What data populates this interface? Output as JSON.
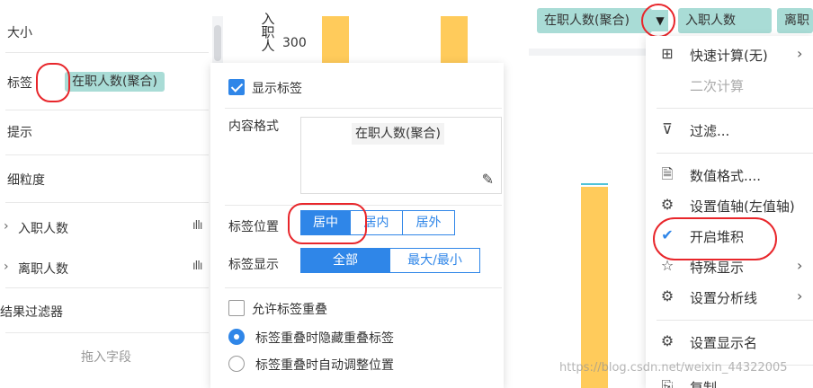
{
  "left_panel": {
    "rows": {
      "size": "大小",
      "label": "标签",
      "tooltip": "提示",
      "granularity": "细粒度",
      "field_hire": "入职人数",
      "field_leave": "离职人数",
      "result_filter": "结果过滤器"
    },
    "label_pill": "在职人数(聚合)",
    "bar_icon_1": "ıllı",
    "bar_icon_2": "ıllı",
    "tree_arrow_1": "›",
    "tree_arrow_2": "›",
    "drop_hint": "拖入字段"
  },
  "chart": {
    "y_axis_label": "入职人",
    "y_tick": "300",
    "bar_color": "#ffcb5b",
    "top_pills": {
      "employees": "在职人数(聚合)",
      "hires": "入职人数",
      "leaves": "离职"
    },
    "dropdown_arrow": "▼"
  },
  "label_popup": {
    "show_label": "显示标签",
    "content_format": "内容格式",
    "format_token": "在职人数(聚合)",
    "edit_icon": "✎",
    "label_position": "标签位置",
    "position_options": [
      "居中",
      "居内",
      "居外"
    ],
    "position_selected": "居中",
    "label_display": "标签显示",
    "display_options": [
      "全部",
      "最大/最小"
    ],
    "display_selected": "全部",
    "allow_overlap": "允许标签重叠",
    "overlap_hide": "标签重叠时隐藏重叠标签",
    "overlap_adjust": "标签重叠时自动调整位置",
    "accent": "#2f86e8"
  },
  "context_menu": {
    "quick_calc": "快速计算(无)",
    "secondary_calc": "二次计算",
    "filter": "过滤...",
    "number_format": "数值格式....",
    "set_axis": "设置值轴(左值轴)",
    "enable_stack": "开启堆积",
    "special_display": "特殊显示",
    "analysis_line": "设置分析线",
    "display_name": "设置显示名",
    "copy": "复制",
    "icons": {
      "quick_calc": "⊞",
      "filter": "⊽",
      "number_format": "🗎",
      "set_axis": "⚙",
      "enable_stack": "✔",
      "special_display": "☆",
      "analysis_line": "⚙",
      "display_name": "⚙",
      "copy": "⎘"
    },
    "chevron": "›"
  },
  "watermark": "https://blog.csdn.net/weixin_44322005",
  "highlight_color": "#e8262b"
}
